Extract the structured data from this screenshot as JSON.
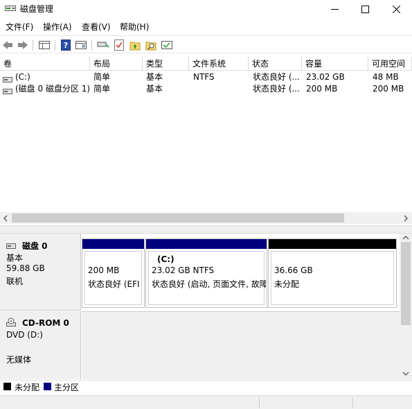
{
  "window": {
    "title": "磁盘管理",
    "icon": "disk-management-icon"
  },
  "menu": [
    "文件(F)",
    "操作(A)",
    "查看(V)",
    "帮助(H)"
  ],
  "toolbar": {
    "icons": [
      "back-arrow-icon",
      "forward-arrow-icon",
      "console-tree-icon",
      "help-icon",
      "properties-icon",
      "connect-drive-icon",
      "check-icon",
      "folder-up-icon",
      "folder-search-icon",
      "rescan-icon"
    ]
  },
  "volume_table": {
    "columns": [
      "卷",
      "布局",
      "类型",
      "文件系统",
      "状态",
      "容量",
      "可用空间"
    ],
    "rows": [
      [
        "(C:)",
        "简单",
        "基本",
        "NTFS",
        "状态良好 (...",
        "23.02 GB",
        "48 MB"
      ],
      [
        "(磁盘 0 磁盘分区 1)",
        "简单",
        "基本",
        "",
        "状态良好 (...",
        "200 MB",
        "200 MB"
      ]
    ]
  },
  "disks": [
    {
      "name": "磁盘 0",
      "type": "基本",
      "size": "59.88 GB",
      "state": "联机",
      "partitions": [
        {
          "label": "",
          "size_line": "200 MB",
          "status_line": "状态良好 (EFI",
          "bar_color": "#00007f"
        },
        {
          "label": "(C:)",
          "size_line": "23.02 GB NTFS",
          "status_line": "状态良好 (启动, 页面文件, 故障",
          "bar_color": "#00007f"
        },
        {
          "label": "",
          "size_line": "36.66 GB",
          "status_line": "未分配",
          "bar_color": "#000000"
        }
      ]
    },
    {
      "name": "CD-ROM 0",
      "type": "DVD (D:)",
      "state": "无媒体"
    }
  ],
  "legend": [
    {
      "label": "未分配",
      "color": "#000000"
    },
    {
      "label": "主分区",
      "color": "#00007f"
    }
  ]
}
